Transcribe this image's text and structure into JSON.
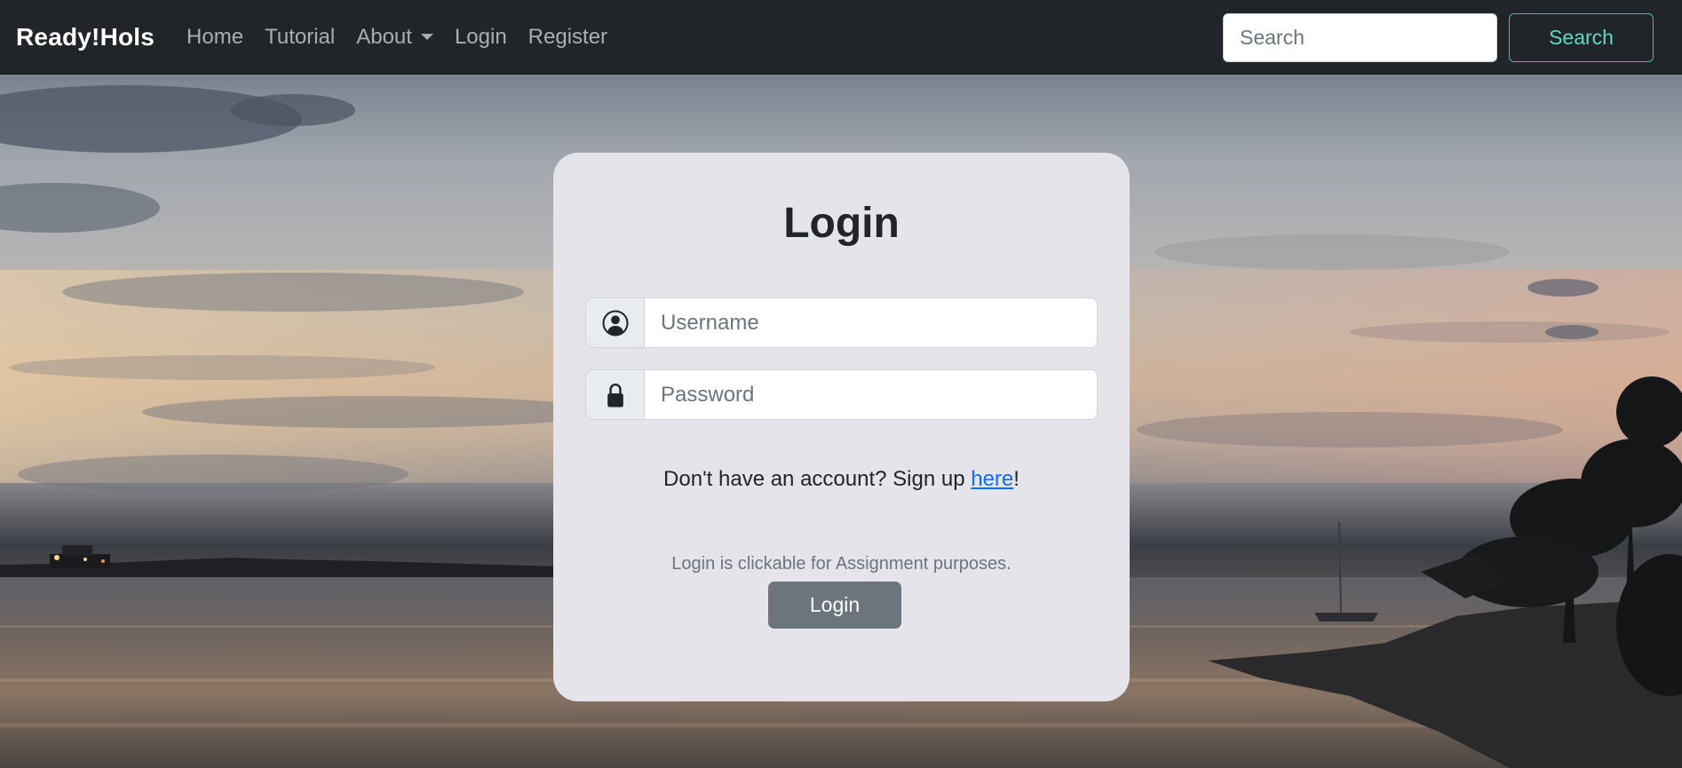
{
  "navbar": {
    "brand": "Ready!Hols",
    "links": [
      {
        "label": "Home"
      },
      {
        "label": "Tutorial"
      },
      {
        "label": "About"
      },
      {
        "label": "Login"
      },
      {
        "label": "Register"
      }
    ],
    "search": {
      "placeholder": "Search",
      "button_label": "Search"
    }
  },
  "login_card": {
    "title": "Login",
    "username_placeholder": "Username",
    "password_placeholder": "Password",
    "signup_prefix": "Don't have an account? Sign up ",
    "signup_link": "here",
    "signup_suffix": "!",
    "note": "Login is clickable for Assignment purposes.",
    "button_label": "Login"
  },
  "icons": {
    "user": "user-circle-icon",
    "lock": "lock-icon",
    "dropdown": "caret-down-icon"
  },
  "colors": {
    "navbar_bg": "#212529",
    "card_bg": "#e4e4ea",
    "search_button": "#5ed8c4",
    "login_button": "#6c757d",
    "link": "#0d6efd"
  }
}
